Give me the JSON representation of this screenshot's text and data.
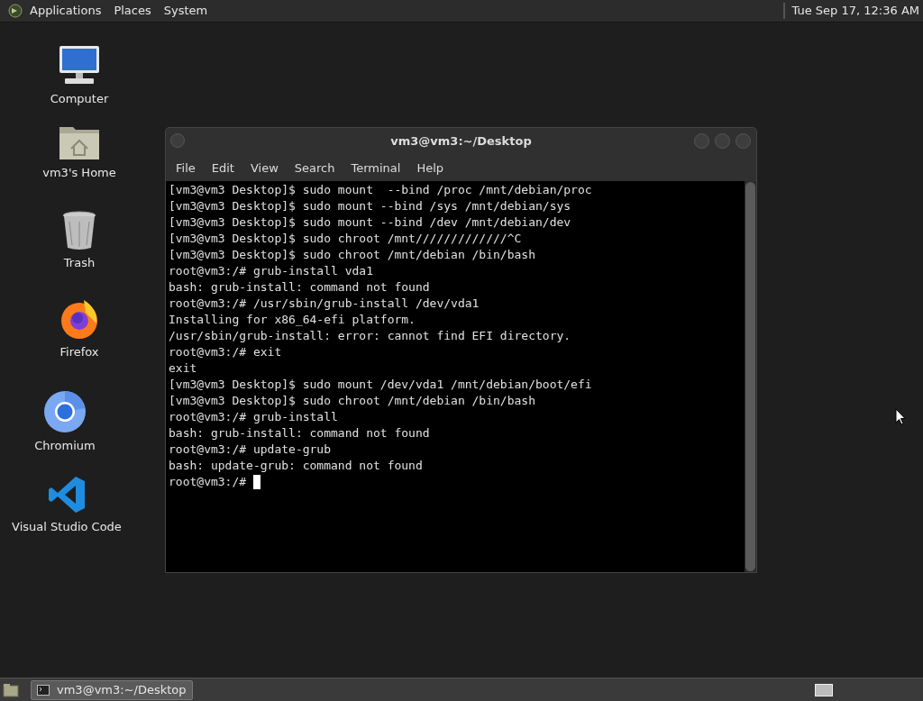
{
  "top_panel": {
    "menus": [
      "Applications",
      "Places",
      "System"
    ],
    "clock": "Tue Sep 17, 12:36 AM"
  },
  "desktop_icons": [
    {
      "kind": "computer",
      "label": "Computer"
    },
    {
      "kind": "home",
      "label": "vm3's Home"
    },
    {
      "kind": "trash",
      "label": "Trash"
    },
    {
      "kind": "firefox",
      "label": "Firefox"
    },
    {
      "kind": "chromium",
      "label": "Chromium"
    },
    {
      "kind": "vscode",
      "label": "Visual Studio Code"
    }
  ],
  "terminal": {
    "title": "vm3@vm3:~/Desktop",
    "menu": [
      "File",
      "Edit",
      "View",
      "Search",
      "Terminal",
      "Help"
    ],
    "lines": [
      "[vm3@vm3 Desktop]$ sudo mount  --bind /proc /mnt/debian/proc",
      "[vm3@vm3 Desktop]$ sudo mount --bind /sys /mnt/debian/sys",
      "[vm3@vm3 Desktop]$ sudo mount --bind /dev /mnt/debian/dev",
      "[vm3@vm3 Desktop]$ sudo chroot /mnt/////////////^C",
      "[vm3@vm3 Desktop]$ sudo chroot /mnt/debian /bin/bash",
      "root@vm3:/# grub-install vda1",
      "bash: grub-install: command not found",
      "root@vm3:/# /usr/sbin/grub-install /dev/vda1",
      "Installing for x86_64-efi platform.",
      "/usr/sbin/grub-install: error: cannot find EFI directory.",
      "root@vm3:/# exit",
      "exit",
      "[vm3@vm3 Desktop]$ sudo mount /dev/vda1 /mnt/debian/boot/efi",
      "[vm3@vm3 Desktop]$ sudo chroot /mnt/debian /bin/bash",
      "root@vm3:/# grub-install",
      "bash: grub-install: command not found",
      "root@vm3:/# update-grub",
      "bash: update-grub: command not found"
    ],
    "prompt": "root@vm3:/#"
  },
  "taskbar": {
    "tasks": [
      {
        "label": "vm3@vm3:~/Desktop",
        "selected": true
      }
    ]
  }
}
